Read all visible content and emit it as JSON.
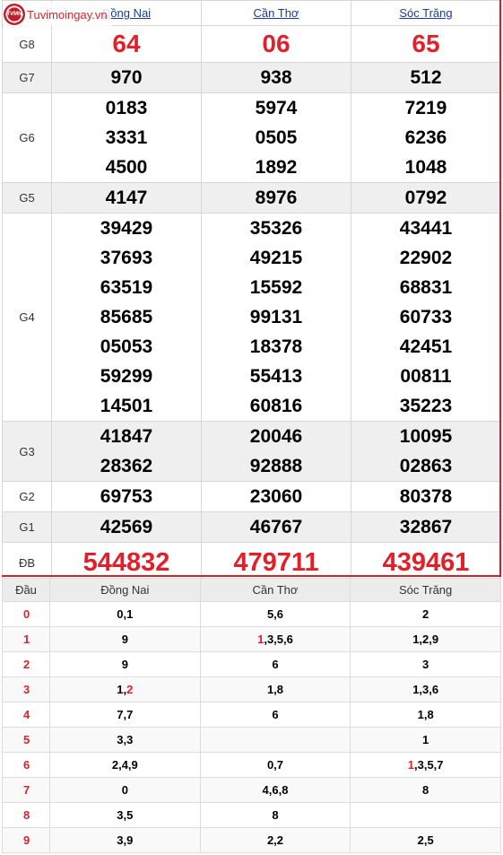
{
  "site": {
    "logo_text": "Tuvimoingay.vn",
    "badge_text": "TVMN"
  },
  "provinces": [
    "Đồng Nai",
    "Cần Thơ",
    "Sóc Trăng"
  ],
  "prizes": [
    {
      "label": "G8",
      "values": [
        [
          "64"
        ],
        [
          "06"
        ],
        [
          "65"
        ]
      ]
    },
    {
      "label": "G7",
      "values": [
        [
          "970"
        ],
        [
          "938"
        ],
        [
          "512"
        ]
      ]
    },
    {
      "label": "G6",
      "values": [
        [
          "0183",
          "3331",
          "4500"
        ],
        [
          "5974",
          "0505",
          "1892"
        ],
        [
          "7219",
          "6236",
          "1048"
        ]
      ]
    },
    {
      "label": "G5",
      "values": [
        [
          "4147"
        ],
        [
          "8976"
        ],
        [
          "0792"
        ]
      ]
    },
    {
      "label": "G4",
      "values": [
        [
          "39429",
          "37693",
          "63519",
          "85685",
          "05053",
          "59299",
          "14501"
        ],
        [
          "35326",
          "49215",
          "15592",
          "99131",
          "18378",
          "55413",
          "60816"
        ],
        [
          "43441",
          "22902",
          "68831",
          "60733",
          "42451",
          "00811",
          "35223"
        ]
      ]
    },
    {
      "label": "G3",
      "values": [
        [
          "41847",
          "28362"
        ],
        [
          "20046",
          "92888"
        ],
        [
          "10095",
          "02863"
        ]
      ]
    },
    {
      "label": "G2",
      "values": [
        [
          "69753"
        ],
        [
          "23060"
        ],
        [
          "80378"
        ]
      ]
    },
    {
      "label": "G1",
      "values": [
        [
          "42569"
        ],
        [
          "46767"
        ],
        [
          "32867"
        ]
      ]
    },
    {
      "label": "ĐB",
      "values": [
        [
          "544832"
        ],
        [
          "479711"
        ],
        [
          "439461"
        ]
      ]
    }
  ],
  "dau_table": {
    "header": [
      "Đầu",
      "Đồng Nai",
      "Cần Thơ",
      "Sóc Trăng"
    ],
    "rows": [
      {
        "dau": "0",
        "cells": [
          [
            {
              "t": "0,1"
            }
          ],
          [
            {
              "t": "5,6"
            }
          ],
          [
            {
              "t": "2"
            }
          ]
        ]
      },
      {
        "dau": "1",
        "cells": [
          [
            {
              "t": "9"
            }
          ],
          [
            {
              "t": "1",
              "hl": true
            },
            {
              "t": ",3,5,6"
            }
          ],
          [
            {
              "t": "1,2,9"
            }
          ]
        ]
      },
      {
        "dau": "2",
        "cells": [
          [
            {
              "t": "9"
            }
          ],
          [
            {
              "t": "6"
            }
          ],
          [
            {
              "t": "3"
            }
          ]
        ]
      },
      {
        "dau": "3",
        "cells": [
          [
            {
              "t": "1,"
            },
            {
              "t": "2",
              "hl": true
            }
          ],
          [
            {
              "t": "1,8"
            }
          ],
          [
            {
              "t": "1,3,6"
            }
          ]
        ]
      },
      {
        "dau": "4",
        "cells": [
          [
            {
              "t": "7,7"
            }
          ],
          [
            {
              "t": "6"
            }
          ],
          [
            {
              "t": "1,8"
            }
          ]
        ]
      },
      {
        "dau": "5",
        "cells": [
          [
            {
              "t": "3,3"
            }
          ],
          [],
          [
            {
              "t": "1"
            }
          ]
        ]
      },
      {
        "dau": "6",
        "cells": [
          [
            {
              "t": "2,4,9"
            }
          ],
          [
            {
              "t": "0,7"
            }
          ],
          [
            {
              "t": "1",
              "hl": true
            },
            {
              "t": ",3,5,7"
            }
          ]
        ]
      },
      {
        "dau": "7",
        "cells": [
          [
            {
              "t": "0"
            }
          ],
          [
            {
              "t": "4,6,8"
            }
          ],
          [
            {
              "t": "8"
            }
          ]
        ]
      },
      {
        "dau": "8",
        "cells": [
          [
            {
              "t": "3,5"
            }
          ],
          [
            {
              "t": "8"
            }
          ],
          []
        ]
      },
      {
        "dau": "9",
        "cells": [
          [
            {
              "t": "3,9"
            }
          ],
          [
            {
              "t": "2,2"
            }
          ],
          [
            {
              "t": "2,5"
            }
          ]
        ]
      }
    ]
  }
}
